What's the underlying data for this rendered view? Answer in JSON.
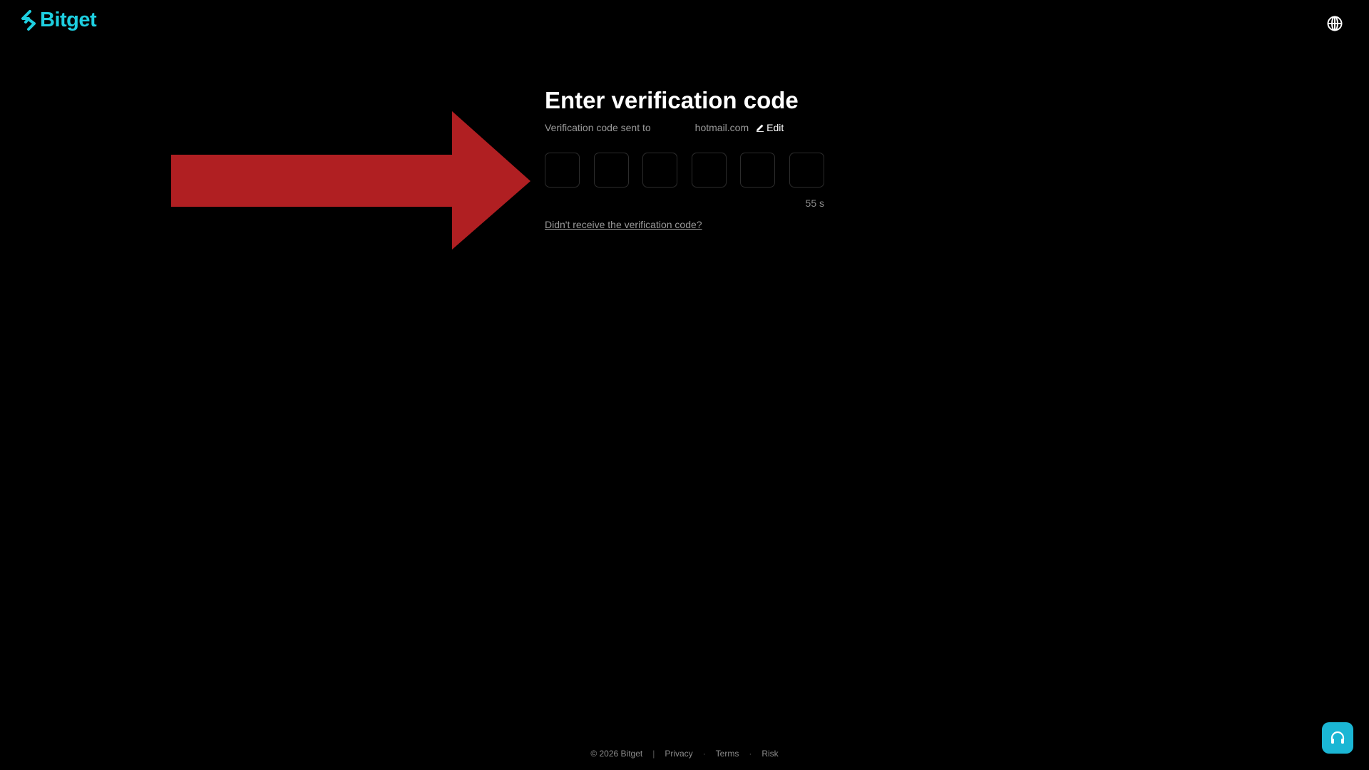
{
  "header": {
    "logo_text": "Bitget",
    "brand_color": "#1ecfe0",
    "language_icon": "globe-icon"
  },
  "main": {
    "title": "Enter verification code",
    "subtitle": "Verification code sent to",
    "email": "hotmail.com",
    "edit_label": "Edit",
    "code_length": 6,
    "timer": "55 s",
    "resend_link": "Didn't receive the verification code?"
  },
  "annotation": {
    "arrow_color": "#b01f22"
  },
  "footer": {
    "copyright": "© 2026 Bitget",
    "links": [
      "Privacy",
      "Terms",
      "Risk"
    ]
  },
  "support": {
    "icon": "headset-icon",
    "color": "#1bb6d4"
  }
}
